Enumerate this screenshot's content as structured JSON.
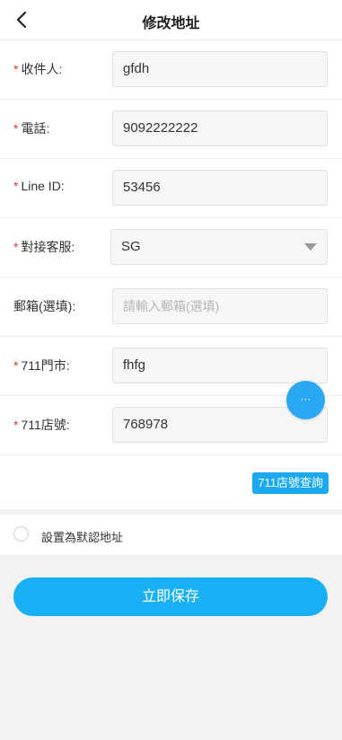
{
  "header": {
    "title": "修改地址",
    "back_icon": "chevron-left-icon"
  },
  "form": {
    "recipient": {
      "required_mark": "*",
      "label": "收件人:",
      "value": "gfdh"
    },
    "phone": {
      "required_mark": "*",
      "label": "電話:",
      "value": "9092222222"
    },
    "line_id": {
      "required_mark": "*",
      "label": "Line ID:",
      "value": "53456"
    },
    "service": {
      "required_mark": "*",
      "label": "對接客服:",
      "value": "SG"
    },
    "email": {
      "label": "郵箱(選填):",
      "placeholder": "請輸入郵箱(選填)"
    },
    "store": {
      "required_mark": "*",
      "label": "711門市:",
      "value": "fhfg"
    },
    "store_no": {
      "required_mark": "*",
      "label": "711店號:",
      "value": "768978"
    },
    "lookup_button": "711店號查詢"
  },
  "default_address": {
    "label": "設置為默認地址"
  },
  "save_button": "立即保存",
  "floating_button": {
    "label": "···"
  },
  "colors": {
    "accent": "#1ab0f5",
    "required": "#e53935"
  }
}
